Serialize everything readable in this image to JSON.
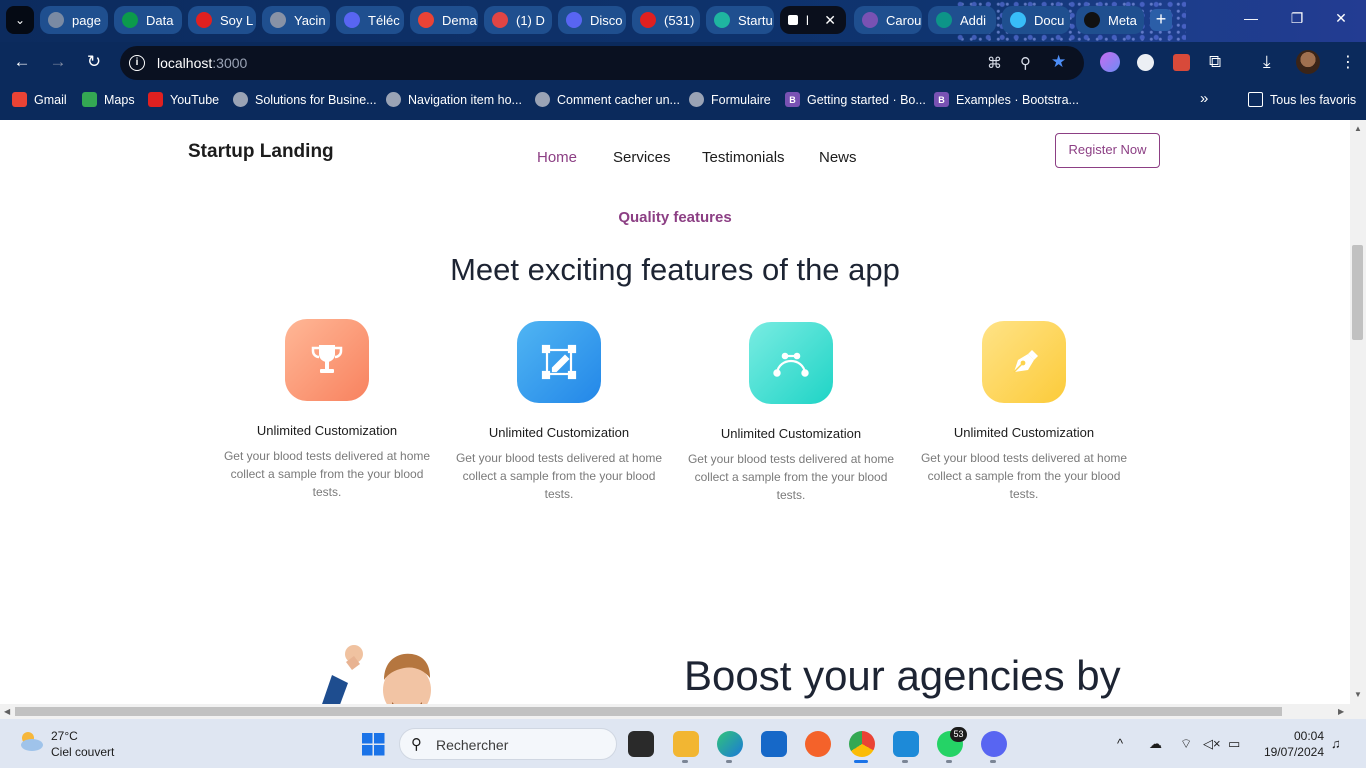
{
  "browser": {
    "tabs": [
      {
        "label": "page",
        "fav_color": "#7a8aa3"
      },
      {
        "label": "Data",
        "fav_color": "#0c9a4c"
      },
      {
        "label": "Soy L",
        "fav_color": "#e02020"
      },
      {
        "label": "Yacin",
        "fav_color": "#8892a6"
      },
      {
        "label": "Téléc",
        "fav_color": "#5865f2"
      },
      {
        "label": "Dema",
        "fav_color": "#ea4335"
      },
      {
        "label": "(1) D",
        "fav_color": "#e04545"
      },
      {
        "label": "Disco",
        "fav_color": "#5865f2"
      },
      {
        "label": "(531)",
        "fav_color": "#e02020"
      },
      {
        "label": "Startu",
        "fav_color": "#1fb5a0"
      },
      {
        "label": "l",
        "fav_color": "#000000"
      },
      {
        "label": "Carou",
        "fav_color": "#7952b3"
      },
      {
        "label": "Addi",
        "fav_color": "#0d9488"
      },
      {
        "label": "Docu",
        "fav_color": "#38bdf8"
      },
      {
        "label": "Meta",
        "fav_color": "#111111"
      }
    ],
    "active_tab_close": "✕",
    "new_tab": "+",
    "url_host": "localhost",
    "url_port": ":3000",
    "bookmarks": [
      {
        "label": "Gmail",
        "icon": "gmail-icon",
        "color": "#ea4335"
      },
      {
        "label": "Maps",
        "icon": "maps-icon",
        "color": "#34a853"
      },
      {
        "label": "YouTube",
        "icon": "youtube-icon",
        "color": "#e02020"
      },
      {
        "label": "Solutions for Busine...",
        "icon": "globe-icon",
        "color": "#9aa3b5"
      },
      {
        "label": "Navigation item ho...",
        "icon": "globe-icon",
        "color": "#9aa3b5"
      },
      {
        "label": "Comment cacher un...",
        "icon": "globe-icon",
        "color": "#9aa3b5"
      },
      {
        "label": "Formulaire",
        "icon": "globe-icon",
        "color": "#9aa3b5"
      },
      {
        "label": "Getting started · Bo...",
        "icon": "bootstrap-icon",
        "color": "#7952b3"
      },
      {
        "label": "Examples · Bootstra...",
        "icon": "bootstrap-icon",
        "color": "#7952b3"
      }
    ],
    "all_bookmarks": "Tous les favoris"
  },
  "site": {
    "brand": "Startup Landing",
    "nav": [
      "Home",
      "Services",
      "Testimonials",
      "News"
    ],
    "register": "Register Now",
    "eyebrow": "Quality features",
    "headline": "Meet exciting features of the app",
    "features": [
      {
        "title": "Unlimited Customization",
        "desc": "Get your blood tests delivered at home collect a sample from the your blood tests.",
        "icon": "trophy-icon"
      },
      {
        "title": "Unlimited Customization",
        "desc": "Get your blood tests delivered at home collect a sample from the your blood tests.",
        "icon": "edit-canvas-icon"
      },
      {
        "title": "Unlimited Customization",
        "desc": "Get your blood tests delivered at home collect a sample from the your blood tests.",
        "icon": "bezier-curve-icon"
      },
      {
        "title": "Unlimited Customization",
        "desc": "Get your blood tests delivered at home collect a sample from the your blood tests.",
        "icon": "pen-nib-icon"
      }
    ],
    "boost_heading": "Boost your agencies by"
  },
  "taskbar": {
    "temperature": "27°C",
    "weather": "Ciel couvert",
    "search_placeholder": "Rechercher",
    "whatsapp_badge": "53",
    "time": "00:04",
    "date": "19/07/2024"
  }
}
